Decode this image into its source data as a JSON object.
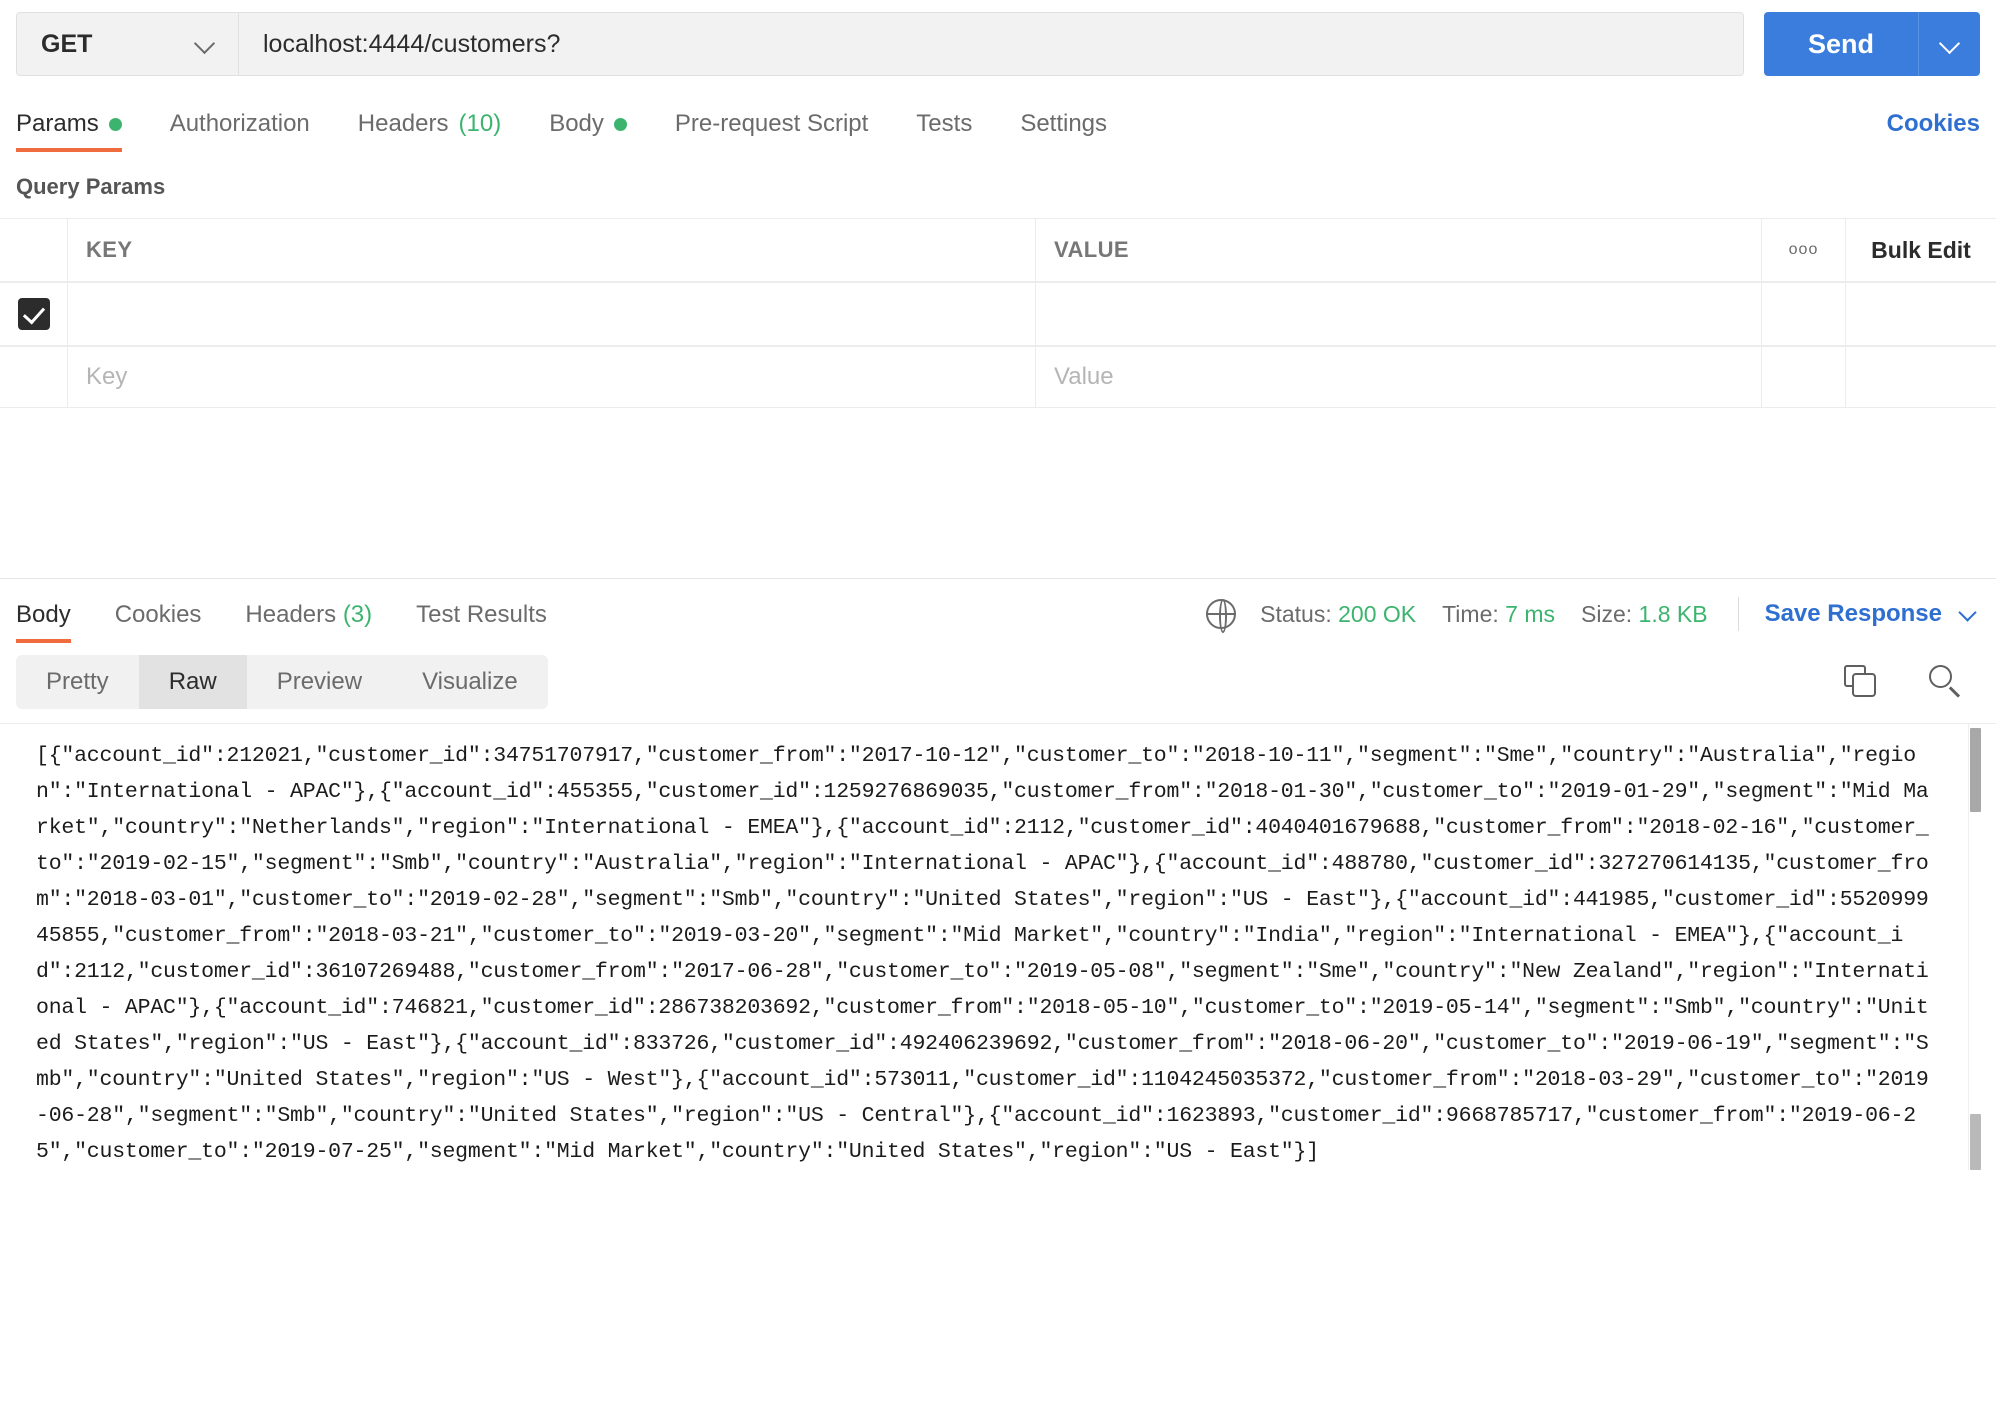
{
  "request": {
    "method": "GET",
    "url": "localhost:4444/customers?",
    "send_label": "Send",
    "tabs": [
      {
        "label": "Params",
        "dot": true,
        "active": true
      },
      {
        "label": "Authorization",
        "dot": false,
        "active": false
      },
      {
        "label": "Headers",
        "count": "(10)",
        "dot": false,
        "active": false
      },
      {
        "label": "Body",
        "dot": true,
        "active": false
      },
      {
        "label": "Pre-request Script",
        "dot": false,
        "active": false
      },
      {
        "label": "Tests",
        "dot": false,
        "active": false
      },
      {
        "label": "Settings",
        "dot": false,
        "active": false
      }
    ],
    "cookies_label": "Cookies"
  },
  "query_params": {
    "title": "Query Params",
    "columns": {
      "key": "KEY",
      "value": "VALUE"
    },
    "bulk_edit_label": "Bulk Edit",
    "options_icon": "ooo",
    "rows": [
      {
        "checked": true,
        "key": "",
        "value": ""
      }
    ],
    "placeholder_row": {
      "key": "Key",
      "value": "Value"
    }
  },
  "response": {
    "tabs": [
      {
        "label": "Body",
        "active": true
      },
      {
        "label": "Cookies",
        "active": false
      },
      {
        "label": "Headers",
        "count": "(3)",
        "active": false
      },
      {
        "label": "Test Results",
        "active": false
      }
    ],
    "status_label": "Status:",
    "status_value": "200 OK",
    "time_label": "Time:",
    "time_value": "7 ms",
    "size_label": "Size:",
    "size_value": "1.8 KB",
    "save_response_label": "Save Response",
    "format_tabs": [
      {
        "label": "Pretty",
        "active": false
      },
      {
        "label": "Raw",
        "active": true
      },
      {
        "label": "Preview",
        "active": false
      },
      {
        "label": "Visualize",
        "active": false
      }
    ],
    "body_raw": "[{\"account_id\":212021,\"customer_id\":34751707917,\"customer_from\":\"2017-10-12\",\"customer_to\":\"2018-10-11\",\"segment\":\"Sme\",\"country\":\"Australia\",\"region\":\"International - APAC\"},{\"account_id\":455355,\"customer_id\":1259276869035,\"customer_from\":\"2018-01-30\",\"customer_to\":\"2019-01-29\",\"segment\":\"Mid Market\",\"country\":\"Netherlands\",\"region\":\"International - EMEA\"},{\"account_id\":2112,\"customer_id\":4040401679688,\"customer_from\":\"2018-02-16\",\"customer_to\":\"2019-02-15\",\"segment\":\"Smb\",\"country\":\"Australia\",\"region\":\"International - APAC\"},{\"account_id\":488780,\"customer_id\":327270614135,\"customer_from\":\"2018-03-01\",\"customer_to\":\"2019-02-28\",\"segment\":\"Smb\",\"country\":\"United States\",\"region\":\"US - East\"},{\"account_id\":441985,\"customer_id\":552099945855,\"customer_from\":\"2018-03-21\",\"customer_to\":\"2019-03-20\",\"segment\":\"Mid Market\",\"country\":\"India\",\"region\":\"International - EMEA\"},{\"account_id\":2112,\"customer_id\":36107269488,\"customer_from\":\"2017-06-28\",\"customer_to\":\"2019-05-08\",\"segment\":\"Sme\",\"country\":\"New Zealand\",\"region\":\"International - APAC\"},{\"account_id\":746821,\"customer_id\":286738203692,\"customer_from\":\"2018-05-10\",\"customer_to\":\"2019-05-14\",\"segment\":\"Smb\",\"country\":\"United States\",\"region\":\"US - East\"},{\"account_id\":833726,\"customer_id\":492406239692,\"customer_from\":\"2018-06-20\",\"customer_to\":\"2019-06-19\",\"segment\":\"Smb\",\"country\":\"United States\",\"region\":\"US - West\"},{\"account_id\":573011,\"customer_id\":1104245035372,\"customer_from\":\"2018-03-29\",\"customer_to\":\"2019-06-28\",\"segment\":\"Smb\",\"country\":\"United States\",\"region\":\"US - Central\"},{\"account_id\":1623893,\"customer_id\":9668785717,\"customer_from\":\"2019-06-25\",\"customer_to\":\"2019-07-25\",\"segment\":\"Mid Market\",\"country\":\"United States\",\"region\":\"US - East\"}]"
  },
  "colors": {
    "accent_blue": "#3b7ddd",
    "link_blue": "#2f6fd0",
    "active_orange": "#ef6c3e",
    "status_green": "#3cb46e"
  }
}
